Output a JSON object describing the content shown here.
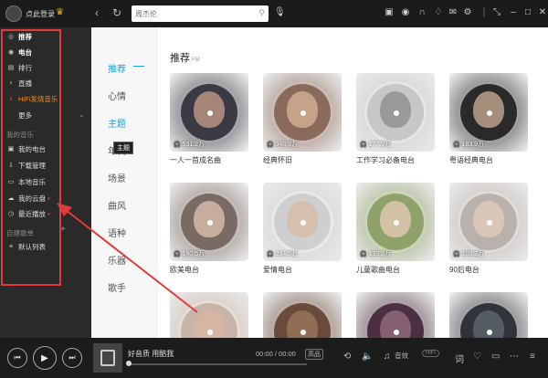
{
  "titlebar": {
    "login": "点此登录",
    "search_placeholder": "周杰伦"
  },
  "sidebar": {
    "items": [
      {
        "label": "推荐",
        "icon": "disc-icon"
      },
      {
        "label": "电台",
        "icon": "radio-icon"
      },
      {
        "label": "排行",
        "icon": "chart-icon"
      },
      {
        "label": "直播",
        "icon": "microphone-icon"
      },
      {
        "label": "HiFi发烧音乐",
        "icon": "hifi-icon"
      },
      {
        "label": "更多",
        "icon": ""
      }
    ],
    "my_music_header": "我的音乐",
    "my_items": [
      {
        "label": "我的电台",
        "icon": "radio-icon"
      },
      {
        "label": "下载管理",
        "icon": "download-icon"
      },
      {
        "label": "本地音乐",
        "icon": "monitor-icon"
      },
      {
        "label": "我的云盘",
        "icon": "cloud-icon"
      },
      {
        "label": "最近播放",
        "icon": "clock-icon"
      }
    ],
    "playlist_header": "自建歌单",
    "playlist_items": [
      {
        "label": "默认列表",
        "icon": "list-icon"
      }
    ]
  },
  "categories": [
    "推荐",
    "心情",
    "主题",
    "年代",
    "场景",
    "曲风",
    "语种",
    "乐器",
    "歌手"
  ],
  "tooltip": "主题",
  "main": {
    "section_title": "推荐",
    "section_sub": "FM",
    "cards": [
      {
        "name": "一人一首成名曲",
        "count": "531.2万",
        "color": "#3a3a44",
        "face": "#c9a08a"
      },
      {
        "name": "经典怀旧",
        "count": "348.8万",
        "color": "#8a6a5a",
        "face": "#d9b59c"
      },
      {
        "name": "工作学习必备电台",
        "count": "177.9万",
        "color": "#c7c7c7",
        "face": "#8a8a8a"
      },
      {
        "name": "粤语经典电台",
        "count": "183.9万",
        "color": "#2a2a2a",
        "face": "#d0b09a"
      },
      {
        "name": "欧美电台",
        "count": "140.5万",
        "color": "#7a6a64",
        "face": "#e0c4b2"
      },
      {
        "name": "爱情电台",
        "count": "234.5万",
        "color": "#cfcfcf",
        "face": "#dab9a2"
      },
      {
        "name": "儿童歌曲电台",
        "count": "133.8万",
        "color": "#8fa26a",
        "face": "#e8cbb6"
      },
      {
        "name": "90后电台",
        "count": "188.2万",
        "color": "#b9b1ac",
        "face": "#e6cdbd"
      },
      {
        "name": "",
        "count": "",
        "color": "#c9b5a8",
        "face": "#d8b7a4"
      },
      {
        "name": "",
        "count": "",
        "color": "#6a4a3a",
        "face": "#a07a60"
      },
      {
        "name": "",
        "count": "",
        "color": "#4a3040",
        "face": "#9a7080"
      },
      {
        "name": "",
        "count": "",
        "color": "#30343a",
        "face": "#606870"
      }
    ]
  },
  "player": {
    "title": "好音质 用酷我",
    "time": "00:00 / 00:00",
    "quality": "高品",
    "sfx": "音效",
    "hifi": "HiFi",
    "progress": 0
  },
  "colors": {
    "accent": "#1aa3d8",
    "highlight": "#e23a3a",
    "hifi": "#f08a1a"
  }
}
